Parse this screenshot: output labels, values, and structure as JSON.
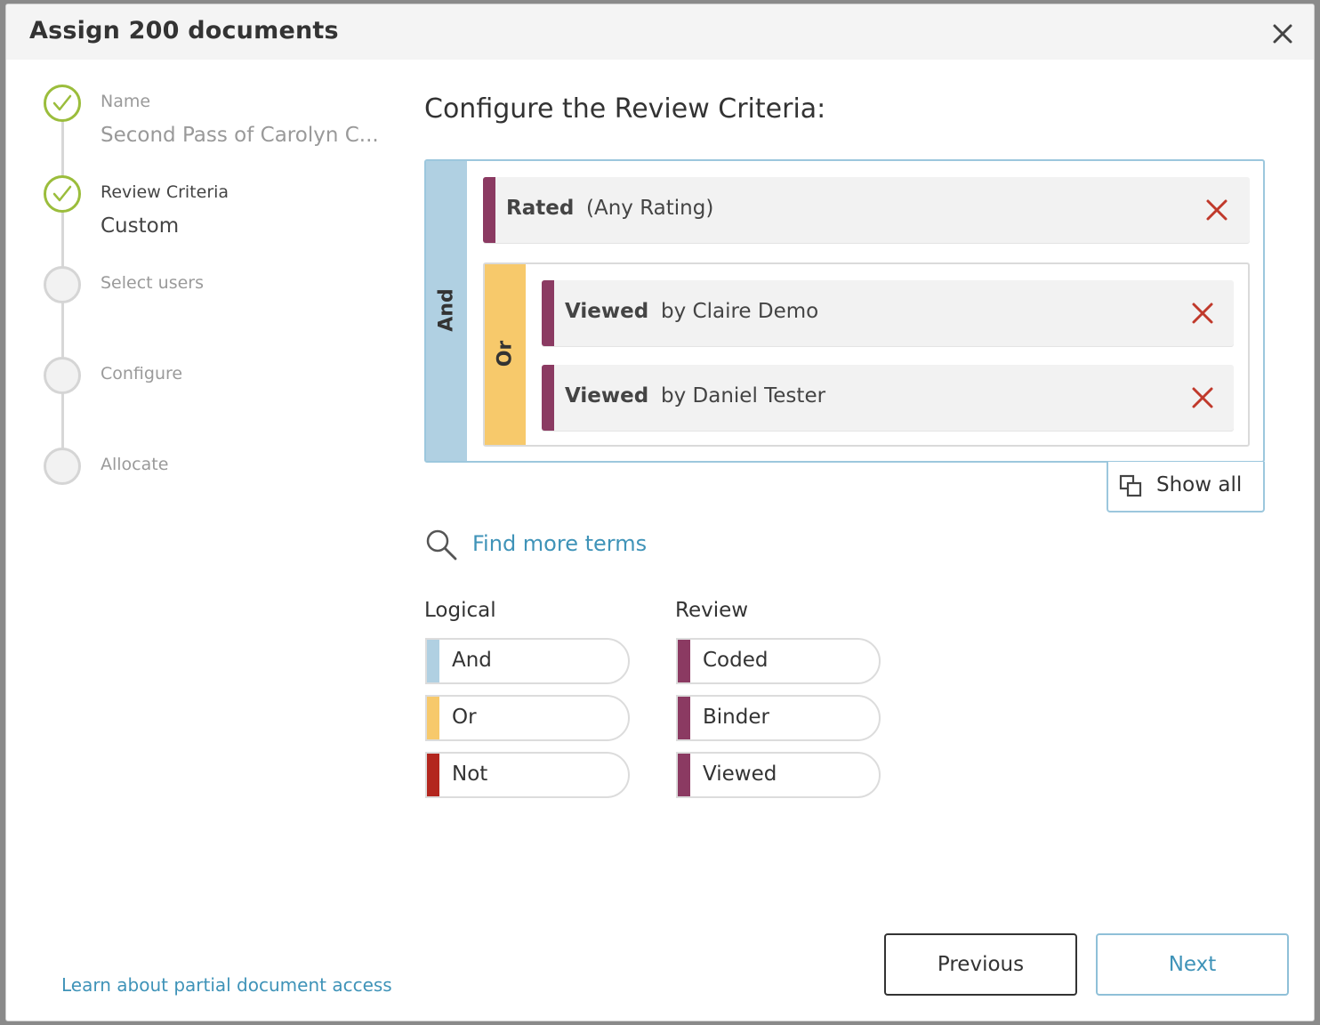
{
  "dialog": {
    "title": "Assign 200 documents",
    "close_icon": "close-icon"
  },
  "steps": [
    {
      "label": "Name",
      "value": "Second Pass of Carolyn C...",
      "status": "done"
    },
    {
      "label": "Review Criteria",
      "value": "Custom",
      "status": "done"
    },
    {
      "label": "Select users",
      "value": "",
      "status": "pending"
    },
    {
      "label": "Configure",
      "value": "",
      "status": "pending"
    },
    {
      "label": "Allocate",
      "value": "",
      "status": "pending"
    }
  ],
  "main": {
    "title": "Configure the Review Criteria:"
  },
  "criteria": {
    "root_operator": "And",
    "terms": [
      {
        "name": "Rated",
        "detail": "(Any Rating)"
      }
    ],
    "group": {
      "operator": "Or",
      "terms": [
        {
          "name": "Viewed",
          "detail": "by Claire Demo"
        },
        {
          "name": "Viewed",
          "detail": "by Daniel Tester"
        }
      ]
    },
    "show_all_label": "Show all"
  },
  "find_more": {
    "label": "Find more terms",
    "icon": "search-icon"
  },
  "palette": {
    "logical": {
      "heading": "Logical",
      "items": [
        {
          "label": "And",
          "color": "#b0d0e2"
        },
        {
          "label": "Or",
          "color": "#f7c96b"
        },
        {
          "label": "Not",
          "color": "#b3261e"
        }
      ]
    },
    "review": {
      "heading": "Review",
      "items": [
        {
          "label": "Coded",
          "color": "#8b3a62"
        },
        {
          "label": "Binder",
          "color": "#8b3a62"
        },
        {
          "label": "Viewed",
          "color": "#8b3a62"
        }
      ]
    }
  },
  "footer": {
    "learn_link": "Learn about partial document access",
    "previous_label": "Previous",
    "next_label": "Next"
  },
  "colors": {
    "accent": "#3f93b8",
    "check": "#9bbd3c",
    "remove": "#c0392b",
    "term_tab": "#8b3a62"
  }
}
